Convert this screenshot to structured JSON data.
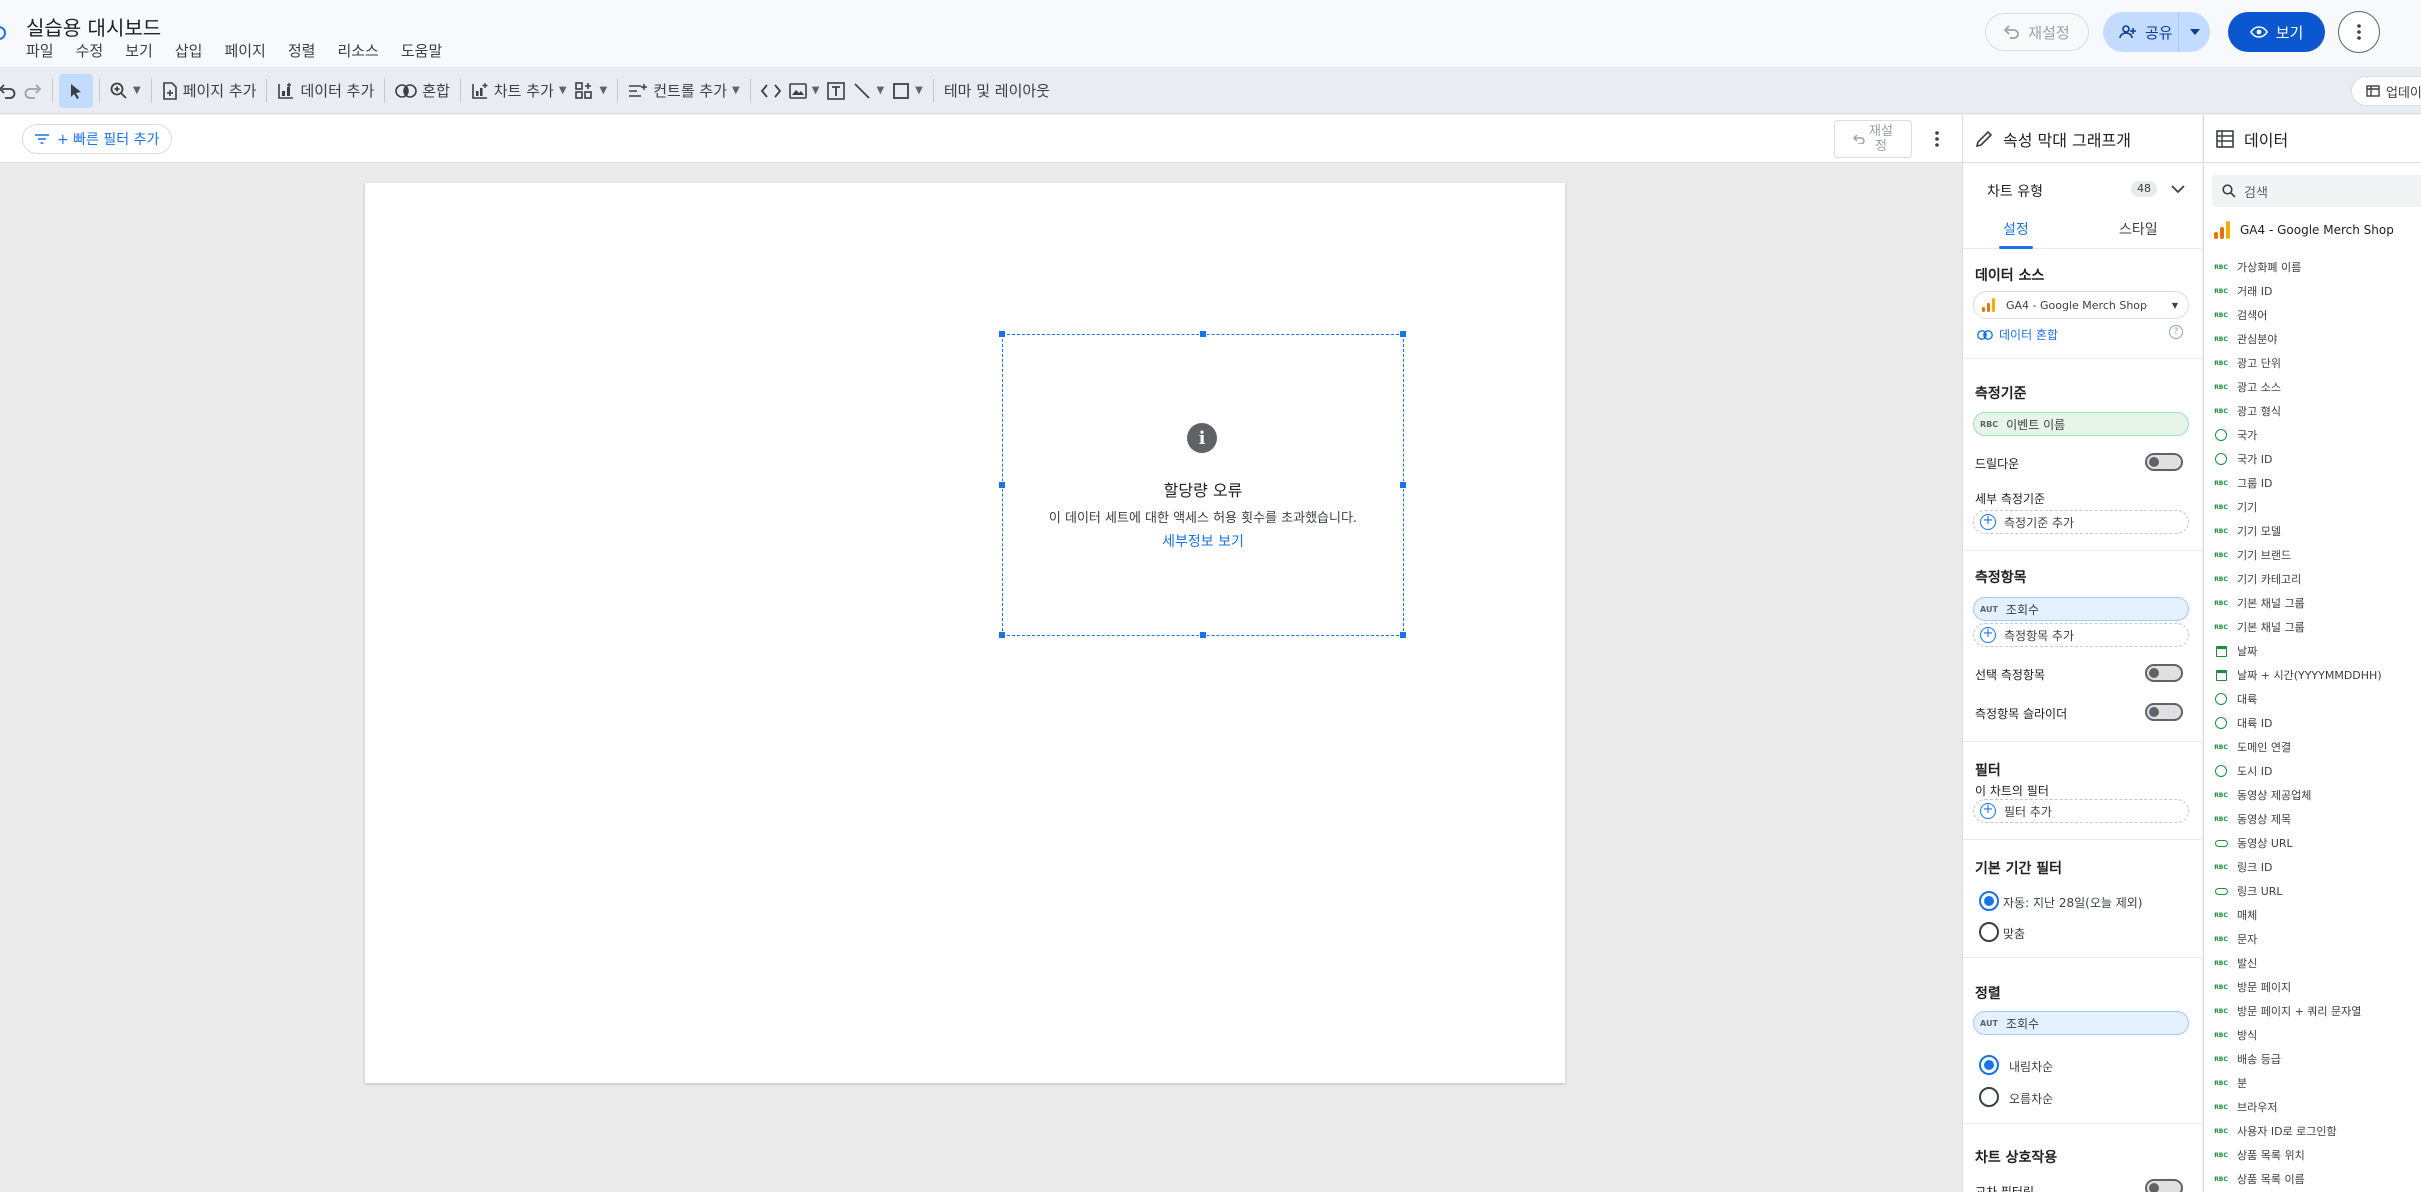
{
  "header": {
    "title": "실습용 대시보드",
    "menu": [
      "파일",
      "수정",
      "보기",
      "삽입",
      "페이지",
      "정렬",
      "리소스",
      "도움말"
    ],
    "reset_label": "재설정",
    "share_label": "공유",
    "view_label": "보기"
  },
  "toolbar": {
    "add_page": "페이지 추가",
    "add_data": "데이터 추가",
    "blend": "혼합",
    "add_chart": "차트 추가",
    "add_control": "컨트롤 추가",
    "theme_layout": "테마 및 레이아웃",
    "update": "업데이트"
  },
  "filterbar": {
    "quick_filter": "+ 빠른 필터 추가",
    "reset_line1": "재설",
    "reset_line2": "정"
  },
  "chart": {
    "error_title": "할당량 오류",
    "error_message": "이 데이터 세트에 대한 액세스 허용 횟수를 초과했습니다.",
    "details_link": "세부정보 보기"
  },
  "properties": {
    "title": "속성 막대 그래프개",
    "chart_type_label": "차트 유형",
    "chart_type_badge": "48",
    "tabs": [
      "설정",
      "스타일"
    ],
    "data_source_title": "데이터 소스",
    "data_source_value": "GA4 - Google Merch Shop",
    "data_blend_link": "데이터 혼합",
    "dimension_title": "측정기준",
    "dimension_tag": "RBC",
    "dimension_value": "이벤트 이름",
    "drilldown_label": "드릴다운",
    "sub_dimension_label": "세부 측정기준",
    "add_dimension": "측정기준 추가",
    "metric_title": "측정항목",
    "metric_tag": "AUT",
    "metric_value": "조회수",
    "add_metric": "측정항목 추가",
    "optional_metric_label": "선택 측정항목",
    "metric_slider_label": "측정항목 슬라이더",
    "filter_title": "필터",
    "chart_filter_label": "이 차트의 필터",
    "add_filter": "필터 추가",
    "date_filter_title": "기본 기간 필터",
    "date_auto": "자동: 지난 28일(오늘 제외)",
    "date_custom": "맞춤",
    "sort_title": "정렬",
    "sort_tag": "AUT",
    "sort_value": "조회수",
    "sort_desc": "내림차순",
    "sort_asc": "오름차순",
    "interaction_title": "차트 상호작용",
    "cross_filter_label": "교차 필터링"
  },
  "data_panel": {
    "title": "데이터",
    "search_placeholder": "검색",
    "source": "GA4 - Google Merch Shop",
    "fields": [
      {
        "type": "RBC",
        "label": "가상화폐 이름"
      },
      {
        "type": "RBC",
        "label": "거래 ID"
      },
      {
        "type": "RBC",
        "label": "검색어"
      },
      {
        "type": "RBC",
        "label": "관심분야"
      },
      {
        "type": "RBC",
        "label": "광고 단위"
      },
      {
        "type": "RBC",
        "label": "광고 소스"
      },
      {
        "type": "RBC",
        "label": "광고 형식"
      },
      {
        "type": "globe",
        "label": "국가"
      },
      {
        "type": "globe",
        "label": "국가 ID"
      },
      {
        "type": "RBC",
        "label": "그룹 ID"
      },
      {
        "type": "RBC",
        "label": "기기"
      },
      {
        "type": "RBC",
        "label": "기기 모델"
      },
      {
        "type": "RBC",
        "label": "기기 브랜드"
      },
      {
        "type": "RBC",
        "label": "기기 카테고리"
      },
      {
        "type": "RBC",
        "label": "기본 채널 그룹"
      },
      {
        "type": "RBC",
        "label": "기본 채널 그룹"
      },
      {
        "type": "cal",
        "label": "날짜"
      },
      {
        "type": "cal",
        "label": "날짜 + 시간(YYYYMMDDHH)"
      },
      {
        "type": "globe",
        "label": "대륙"
      },
      {
        "type": "globe",
        "label": "대륙 ID"
      },
      {
        "type": "RBC",
        "label": "도메인 연결"
      },
      {
        "type": "globe",
        "label": "도시 ID"
      },
      {
        "type": "RBC",
        "label": "동영상 제공업체"
      },
      {
        "type": "RBC",
        "label": "동영상 제목"
      },
      {
        "type": "link",
        "label": "동영상 URL"
      },
      {
        "type": "RBC",
        "label": "링크 ID"
      },
      {
        "type": "link",
        "label": "링크 URL"
      },
      {
        "type": "RBC",
        "label": "매체"
      },
      {
        "type": "RBC",
        "label": "문자"
      },
      {
        "type": "RBC",
        "label": "발신"
      },
      {
        "type": "RBC",
        "label": "방문 페이지"
      },
      {
        "type": "RBC",
        "label": "방문 페이지 + 쿼리 문자열"
      },
      {
        "type": "RBC",
        "label": "방식"
      },
      {
        "type": "RBC",
        "label": "배송 등급"
      },
      {
        "type": "RBC",
        "label": "분"
      },
      {
        "type": "RBC",
        "label": "브라우저"
      },
      {
        "type": "RBC",
        "label": "사용자 ID로 로그인함"
      },
      {
        "type": "RBC",
        "label": "상품 목록 위치"
      },
      {
        "type": "RBC",
        "label": "상품 목록 이름"
      }
    ]
  },
  "colors": {
    "accent": "#1a73e8",
    "primary_button": "#0b57d0",
    "share_button": "#c2dbff",
    "field_green": "#1e8e3e"
  }
}
